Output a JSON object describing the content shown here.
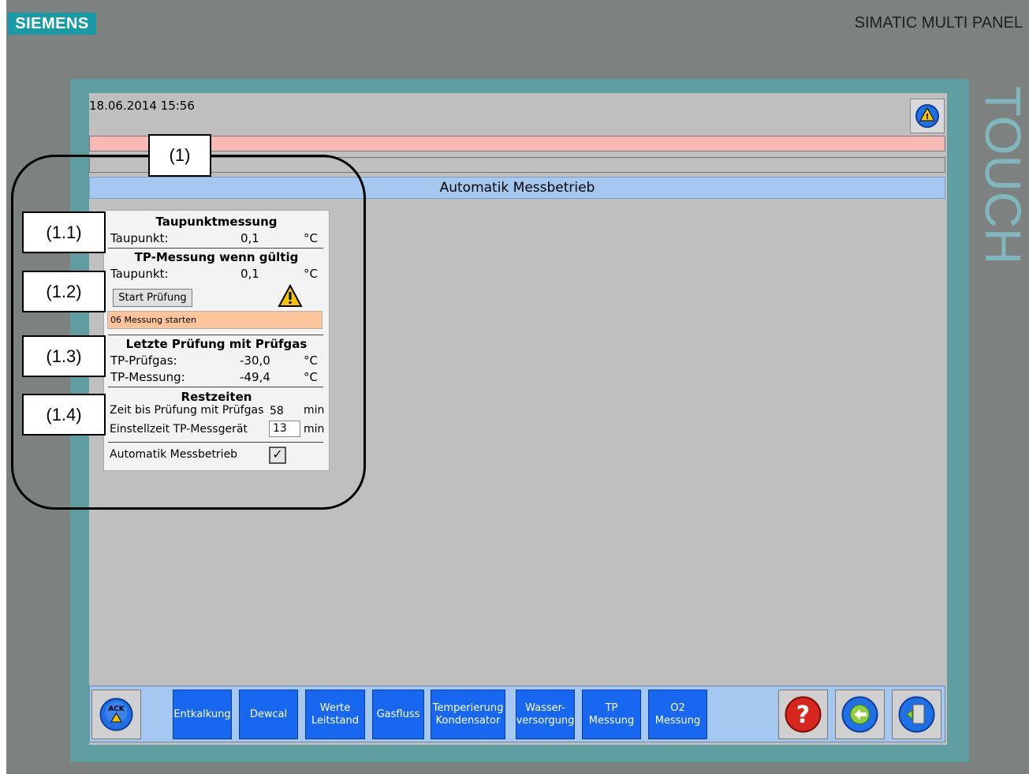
{
  "brand": {
    "logo": "SIEMENS",
    "panel": "SIMATIC MULTI PANEL",
    "side_label": "TOUCH"
  },
  "header": {
    "datetime": "18.06.2014 15:56"
  },
  "page_title": "Automatik Messbetrieb",
  "annotations": {
    "main": "(1)",
    "a": "(1.1)",
    "b": "(1.2)",
    "c": "(1.3)",
    "d": "(1.4)"
  },
  "card": {
    "s1_title": "Taupunktmessung",
    "s1_label": "Taupunkt:",
    "s1_value": "0,1",
    "s1_unit": "°C",
    "s2_title": "TP-Messung wenn gültig",
    "s2_label": "Taupunkt:",
    "s2_value": "0,1",
    "s2_unit": "°C",
    "start_button": "Start Prüfung",
    "status_text": "06 Messung starten",
    "s3_title": "Letzte Prüfung mit Prüfgas",
    "s3_row1_label": "TP-Prüfgas:",
    "s3_row1_value": "-30,0",
    "s3_row1_unit": "°C",
    "s3_row2_label": "TP-Messung:",
    "s3_row2_value": "-49,4",
    "s3_row2_unit": "°C",
    "s4_title": "Restzeiten",
    "s4_row1_label": "Zeit bis Prüfung mit Prüfgas",
    "s4_row1_value": "58",
    "s4_row1_unit": "min",
    "s4_row2_label": "Einstellzeit TP-Messgerät",
    "s4_row2_value": "13",
    "s4_row2_unit": "min",
    "auto_label": "Automatik Messbetrieb",
    "auto_checked": "✓"
  },
  "footer": {
    "ack": "ACK",
    "nav": [
      {
        "l1": "Entkalkung",
        "l2": ""
      },
      {
        "l1": "Dewcal",
        "l2": ""
      },
      {
        "l1": "Werte",
        "l2": "Leitstand"
      },
      {
        "l1": "Gasfluss",
        "l2": ""
      },
      {
        "l1": "Temperierung",
        "l2": "Kondensator"
      },
      {
        "l1": "Wasser-",
        "l2": "versorgung"
      },
      {
        "l1": "TP",
        "l2": "Messung"
      },
      {
        "l1": "O2",
        "l2": "Messung"
      }
    ]
  },
  "colors": {
    "frame": "#5f9ea0",
    "screen": "#bfbfbf",
    "title_bar": "#a4c8ef",
    "nav_button": "#1767f0",
    "status": "#fbc49a",
    "alarm_bar": "#f6b9b4"
  }
}
